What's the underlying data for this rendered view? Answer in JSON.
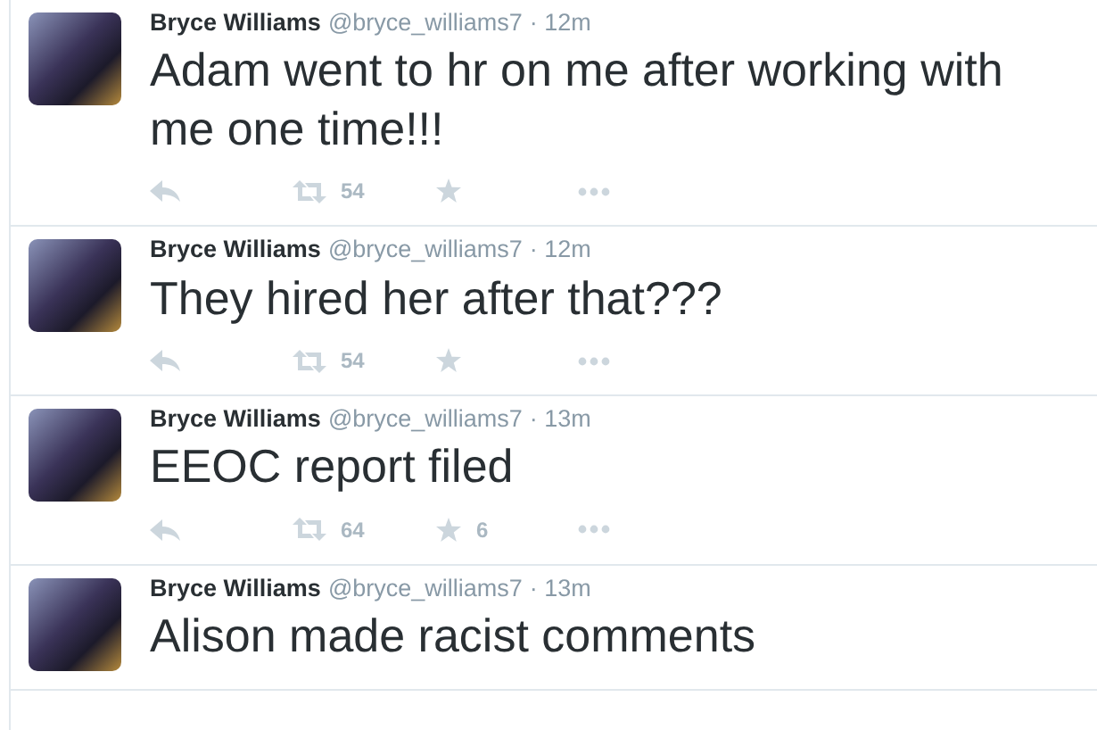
{
  "tweets": [
    {
      "name": "Bryce Williams",
      "handle": "@bryce_williams7",
      "time": "· 12m",
      "text": "Adam went to hr on me after working with me one time!!!",
      "retweets": "54"
    },
    {
      "name": "Bryce Williams",
      "handle": "@bryce_williams7",
      "time": "· 12m",
      "text": "They hired her after that???",
      "retweets": "54"
    },
    {
      "name": "Bryce Williams",
      "handle": "@bryce_williams7",
      "time": "· 13m",
      "text": "EEOC report filed",
      "retweets": "64",
      "favorites": "6"
    },
    {
      "name": "Bryce Williams",
      "handle": "@bryce_williams7",
      "time": "· 13m",
      "text": "Alison made racist comments"
    }
  ]
}
